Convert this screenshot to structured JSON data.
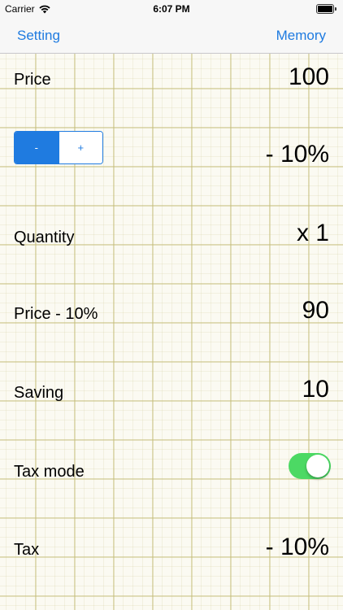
{
  "status_bar": {
    "carrier": "Carrier",
    "time": "6:07 PM",
    "battery_level": 1.0
  },
  "nav": {
    "left_button": "Setting",
    "right_button": "Memory",
    "accent_color": "#1f7be0"
  },
  "rows": {
    "price": {
      "label": "Price",
      "value": "100"
    },
    "discount": {
      "segments": [
        "-",
        "+"
      ],
      "selected_segment": "-",
      "value": "- 10%"
    },
    "quantity": {
      "label": "Quantity",
      "value": "x 1"
    },
    "discounted_price": {
      "label": "Price - 10%",
      "value": "90"
    },
    "saving": {
      "label": "Saving",
      "value": "10"
    },
    "tax_mode": {
      "label": "Tax mode",
      "on": true,
      "toggle_color": "#4cd964"
    },
    "tax": {
      "label": "Tax",
      "value": "- 10%"
    }
  }
}
